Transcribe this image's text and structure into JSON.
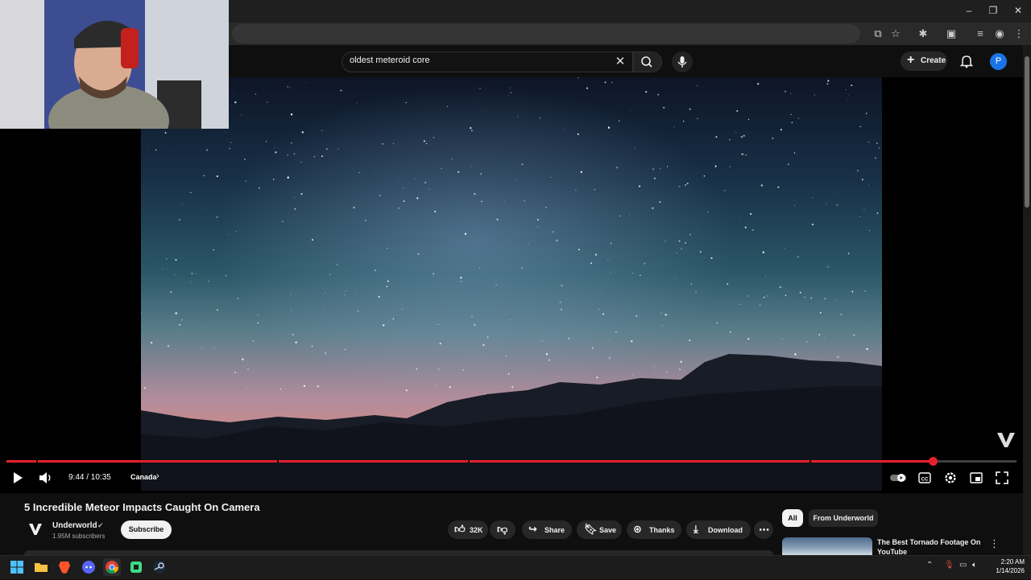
{
  "browser": {
    "window_controls": {
      "minimize": "–",
      "restore": "❐",
      "close": "✕"
    }
  },
  "youtube": {
    "search": {
      "value": "oldest meteroid core"
    },
    "create_label": "Create",
    "avatar_letter": "P"
  },
  "player": {
    "progress_fraction": 0.917,
    "time": "9:44 / 10:35",
    "chapter": "Canada"
  },
  "video_info": {
    "title": "5 Incredible Meteor Impacts Caught On Camera",
    "channel_name": "Underworld",
    "verified_mark": "✔",
    "subscribers": "1.95M subscribers",
    "subscribe_label": "Subscribe",
    "likes": "32K",
    "share_label": "Share",
    "save_label": "Save",
    "thanks_label": "Thanks",
    "download_label": "Download"
  },
  "sidebar": {
    "chips": [
      "All",
      "From Underworld"
    ],
    "recommendation_title": "The Best Tornado Footage On YouTube"
  },
  "taskbar": {
    "time": "2:20 AM",
    "date": "1/14/2026"
  },
  "colors": {
    "accent_red": "#e5202c",
    "avatar_blue": "#1a73e8",
    "background": "#0f0f0f"
  }
}
